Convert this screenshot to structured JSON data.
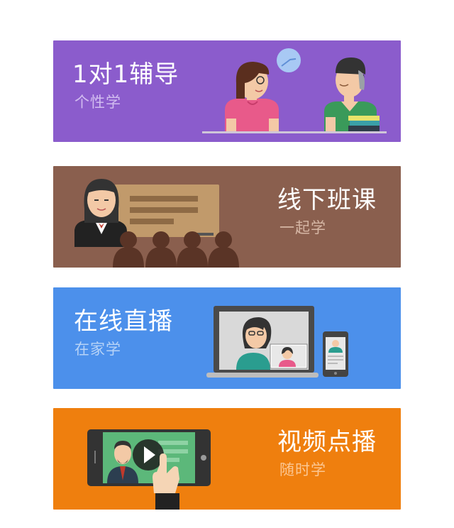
{
  "cards": [
    {
      "title": "1对1辅导",
      "subtitle": "个性学",
      "bg": "#8b5ccc",
      "sub_color": "#d2bdf0",
      "illustration": "tutor-student-icon"
    },
    {
      "title": "线下班课",
      "subtitle": "一起学",
      "bg": "#8a5f4e",
      "sub_color": "#d6b7a5",
      "illustration": "classroom-teacher-icon"
    },
    {
      "title": "在线直播",
      "subtitle": "在家学",
      "bg": "#4c90eb",
      "sub_color": "#b7d3f7",
      "illustration": "live-stream-devices-icon"
    },
    {
      "title": "视频点播",
      "subtitle": "随时学",
      "bg": "#ef7f0e",
      "sub_color": "#fbc793",
      "illustration": "video-on-demand-icon"
    }
  ]
}
